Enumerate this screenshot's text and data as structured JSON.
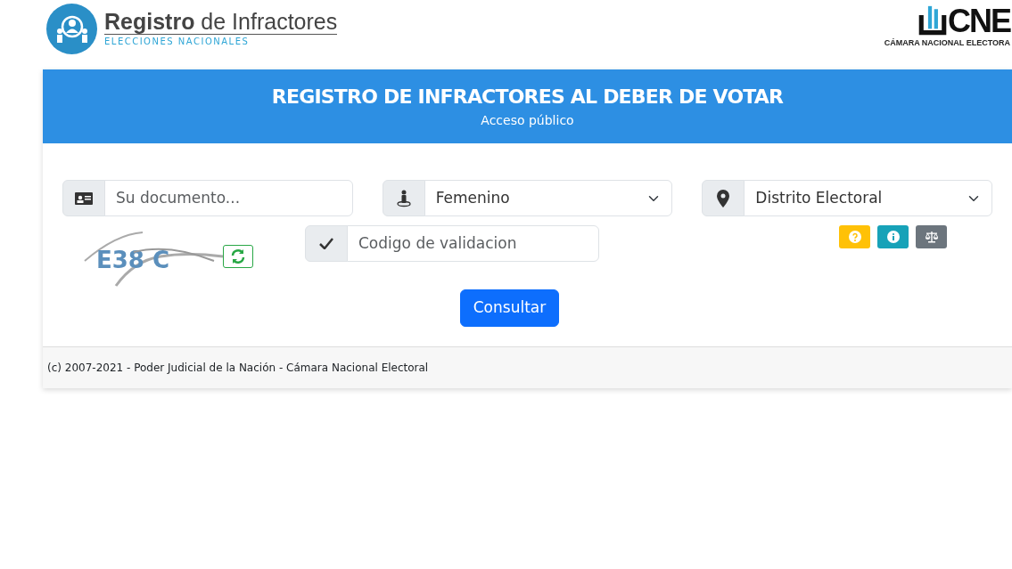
{
  "header": {
    "logo_title_bold": "Registro",
    "logo_title_rest": "de Infractores",
    "logo_subtitle": "ELECCIONES NACIONALES",
    "cne_mark": "CNE",
    "cne_subtitle": "CÁMARA NACIONAL ELECTORA"
  },
  "card": {
    "title": "REGISTRO DE INFRACTORES AL DEBER DE VOTAR",
    "subtitle": "Acceso público"
  },
  "form": {
    "document": {
      "placeholder": "Su documento..."
    },
    "sex": {
      "value": "Femenino"
    },
    "district": {
      "value": "Distrito Electoral"
    },
    "captcha": {
      "text": "E38 C"
    },
    "validation": {
      "placeholder": "Codigo de validacion"
    },
    "help_buttons": [
      {
        "kind": "help",
        "color": "#ffc107"
      },
      {
        "kind": "info",
        "color": "#17a2b8"
      },
      {
        "kind": "legal",
        "color": "#6c757d"
      }
    ],
    "submit": "Consultar"
  },
  "footer": "(c) 2007-2021 - Poder Judicial de la Nación - Cámara Nacional Electoral"
}
